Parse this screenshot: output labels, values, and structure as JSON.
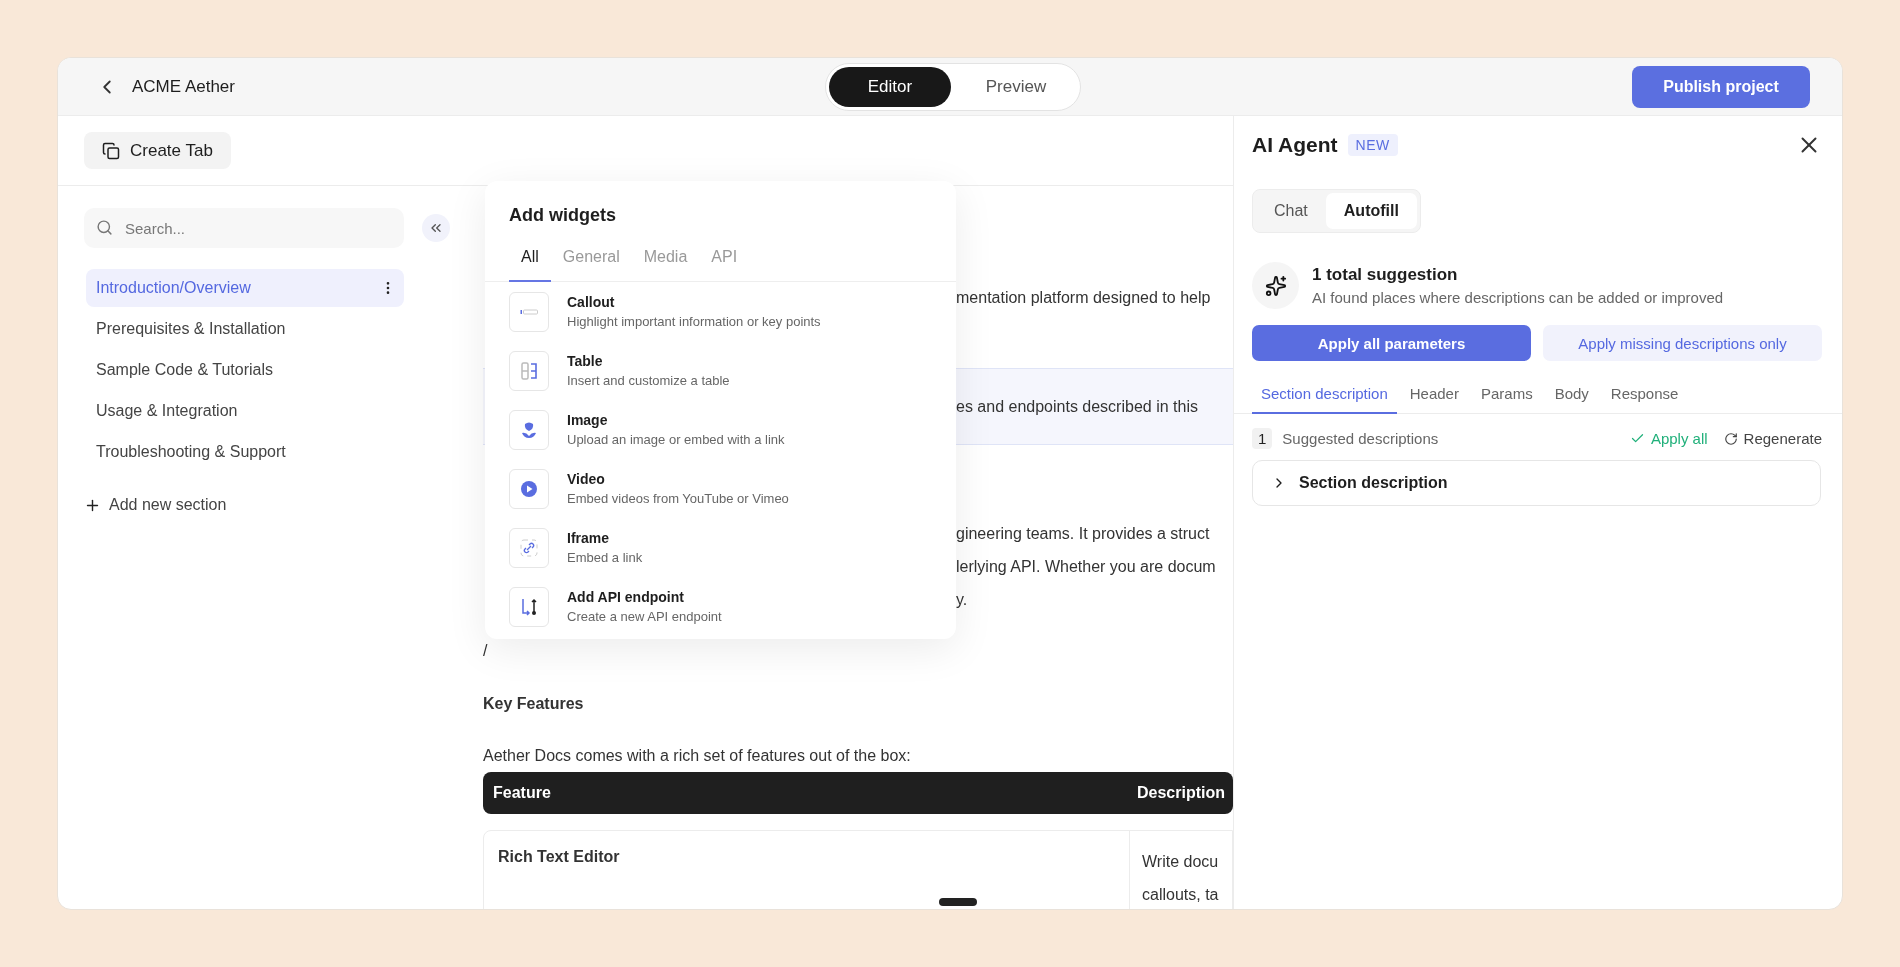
{
  "header": {
    "title": "ACME Aether",
    "mode_tabs": [
      {
        "label": "Editor",
        "selected": true
      },
      {
        "label": "Preview",
        "selected": false
      }
    ],
    "publish_button": "Publish project"
  },
  "toolbar": {
    "create_tab": "Create Tab"
  },
  "sidebar": {
    "search": {
      "placeholder": "Search..."
    },
    "items": [
      {
        "label": "Introduction/Overview",
        "selected": true
      },
      {
        "label": "Prerequisites & Installation",
        "selected": false
      },
      {
        "label": "Sample Code & Tutorials",
        "selected": false
      },
      {
        "label": "Usage & Integration",
        "selected": false
      },
      {
        "label": "Troubleshooting & Support",
        "selected": false
      }
    ],
    "add_section": "Add new section"
  },
  "widgets_popup": {
    "title": "Add widgets",
    "tabs": [
      {
        "label": "All",
        "selected": true
      },
      {
        "label": "General",
        "selected": false
      },
      {
        "label": "Media",
        "selected": false
      },
      {
        "label": "API",
        "selected": false
      }
    ],
    "items": [
      {
        "kind": "callout",
        "title": "Callout",
        "description": "Highlight important information or key points"
      },
      {
        "kind": "table",
        "title": "Table",
        "description": "Insert and customize a table"
      },
      {
        "kind": "image",
        "title": "Image",
        "description": "Upload an image or embed with a link"
      },
      {
        "kind": "video",
        "title": "Video",
        "description": "Embed videos from YouTube or Vimeo"
      },
      {
        "kind": "iframe",
        "title": "Iframe",
        "description": "Embed a link"
      },
      {
        "kind": "api",
        "title": "Add API endpoint",
        "description": "Create a new API endpoint"
      }
    ]
  },
  "content": {
    "blocks": [
      {
        "kind": "paragraph",
        "lines": [
          "mentation platform designed to help"
        ]
      },
      {
        "kind": "callout",
        "lines": [
          "es and endpoints described in this"
        ]
      },
      {
        "kind": "paragraph",
        "lines": [
          "gineering teams. It provides a struct",
          "lerlying API. Whether you are docum",
          "y."
        ]
      }
    ],
    "cursor_line": "/",
    "heading": "Key Features",
    "intro": "Aether Docs comes with a rich set of features out of the box:",
    "table": {
      "columns": [
        "Feature",
        "Description"
      ],
      "rows": [
        {
          "feature": "Rich Text Editor",
          "description_lines": [
            "Write docu",
            "callouts, ta"
          ]
        }
      ]
    }
  },
  "ai_panel": {
    "title": "AI Agent",
    "badge": "NEW",
    "mode_tabs": [
      {
        "label": "Chat",
        "selected": false
      },
      {
        "label": "Autofill",
        "selected": true
      }
    ],
    "summary": {
      "title": "1 total suggestion",
      "subtitle": "AI found places where descriptions can be added or improved"
    },
    "primary_button": "Apply all parameters",
    "secondary_button": "Apply missing descriptions only",
    "tabs": [
      {
        "label": "Section description",
        "selected": true
      },
      {
        "label": "Header",
        "selected": false
      },
      {
        "label": "Params",
        "selected": false
      },
      {
        "label": "Body",
        "selected": false
      },
      {
        "label": "Response",
        "selected": false
      }
    ],
    "count": "1",
    "count_label": "Suggested descriptions",
    "apply_all": "Apply all",
    "regenerate": "Regenerate",
    "accordion": {
      "title": "Section description",
      "expanded": false
    }
  }
}
